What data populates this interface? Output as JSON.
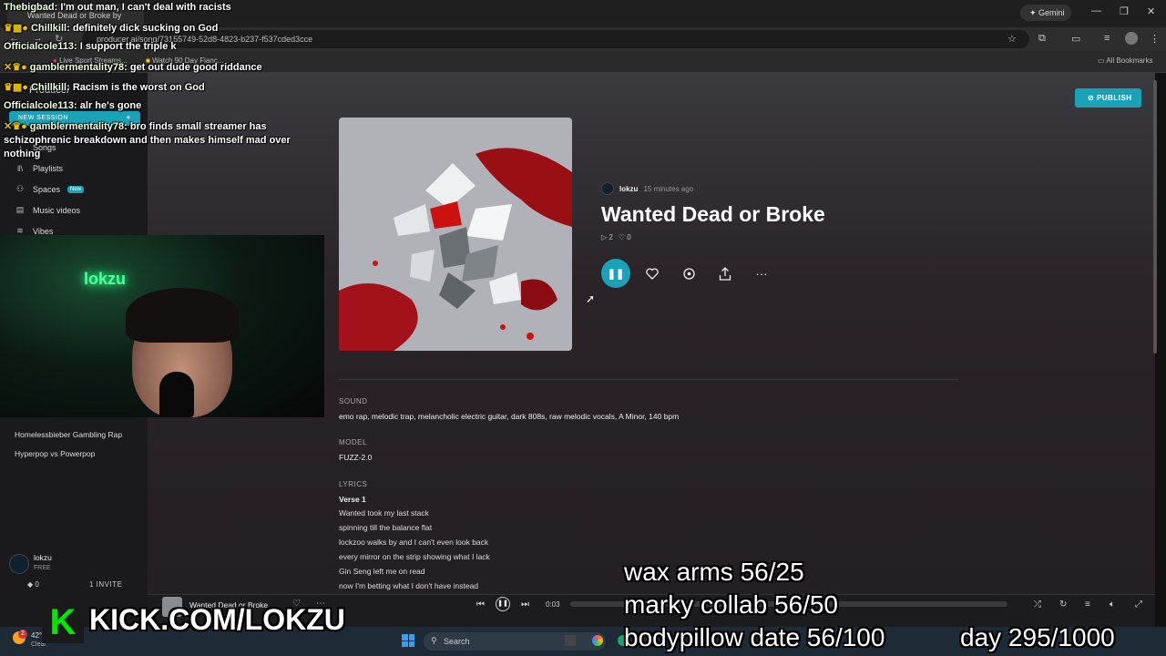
{
  "browser": {
    "tab_title": "Wanted Dead or Broke by",
    "url": "producer.ai/song/73155749-52d8-4823-b237-f537cded3cce",
    "gemini_label": "Gemini",
    "bookmarks": [
      "Live Sport Streams...",
      "Watch 90 Day Fianc..."
    ],
    "all_bookmarks": "All Bookmarks"
  },
  "sidebar": {
    "brand": "Producer",
    "new_session": "NEW SESSION",
    "items": [
      {
        "label": "Songs",
        "icon": "music-note-icon"
      },
      {
        "label": "Playlists",
        "icon": "library-icon"
      },
      {
        "label": "Spaces",
        "icon": "spaces-icon",
        "badge": "New"
      },
      {
        "label": "Music videos",
        "icon": "film-icon"
      },
      {
        "label": "Vibes",
        "icon": "vibes-icon"
      }
    ],
    "sessions": [
      "Homelessbieber Gambling Rap",
      "Hyperpop vs Powerpop"
    ],
    "user": {
      "name": "lokzu",
      "plan": "FREE",
      "credits": "0",
      "invite": "1 INVITE"
    }
  },
  "song": {
    "artist": "lokzu",
    "time_ago": "15 minutes ago",
    "title": "Wanted Dead or Broke",
    "plays": "2",
    "likes": "0",
    "publish_label": "PUBLISH",
    "sound_label": "SOUND",
    "sound": "emo rap, melodic trap, melancholic electric guitar, dark 808s, raw melodic vocals, A Minor, 140 bpm",
    "model_label": "MODEL",
    "model": "FUZZ-2.0",
    "lyrics_label": "LYRICS",
    "verse_label": "Verse 1",
    "lyrics": [
      "Wanted took my last stack",
      "spinning till the balance flat",
      "lockzoo walks by and I can't even look back",
      "every mirror on the strip showing what I lack",
      "Gin Seng left me on read",
      "now I'm betting what I don't have instead"
    ]
  },
  "player": {
    "title": "Wanted Dead or Broke",
    "time": "0:03"
  },
  "taskbar": {
    "weather_temp": "42°",
    "weather_desc": "Clear",
    "search": "Search",
    "notification_count": "2"
  },
  "stream": {
    "chat": [
      {
        "user": "Thebigbad",
        "msg": "I'm out man, I can't deal with racists"
      },
      {
        "user": "Chillkill",
        "msg": "definitely dick sucking on God"
      },
      {
        "user": "Officialcole113",
        "msg": "I support the triple k"
      },
      {
        "user": "gamblermentality78",
        "msg": "get out dude good riddance"
      },
      {
        "user": "Chillkill",
        "msg": "Racism is the worst on God"
      },
      {
        "user": "Officialcole113",
        "msg": "alr he's gone"
      },
      {
        "user": "gamblermentality78",
        "msg": "bro finds small streamer has schizophrenic breakdown and then makes himself mad over nothing"
      }
    ],
    "neon_sign": "lokzu",
    "goal_1": "wax arms 56/25",
    "goal_2": "marky collab 56/50",
    "goal_3": "bodypillow date 56/100",
    "day_counter": "day 295/1000",
    "kick_logo": "K",
    "kick_url": "KICK.COM/LOKZU"
  }
}
